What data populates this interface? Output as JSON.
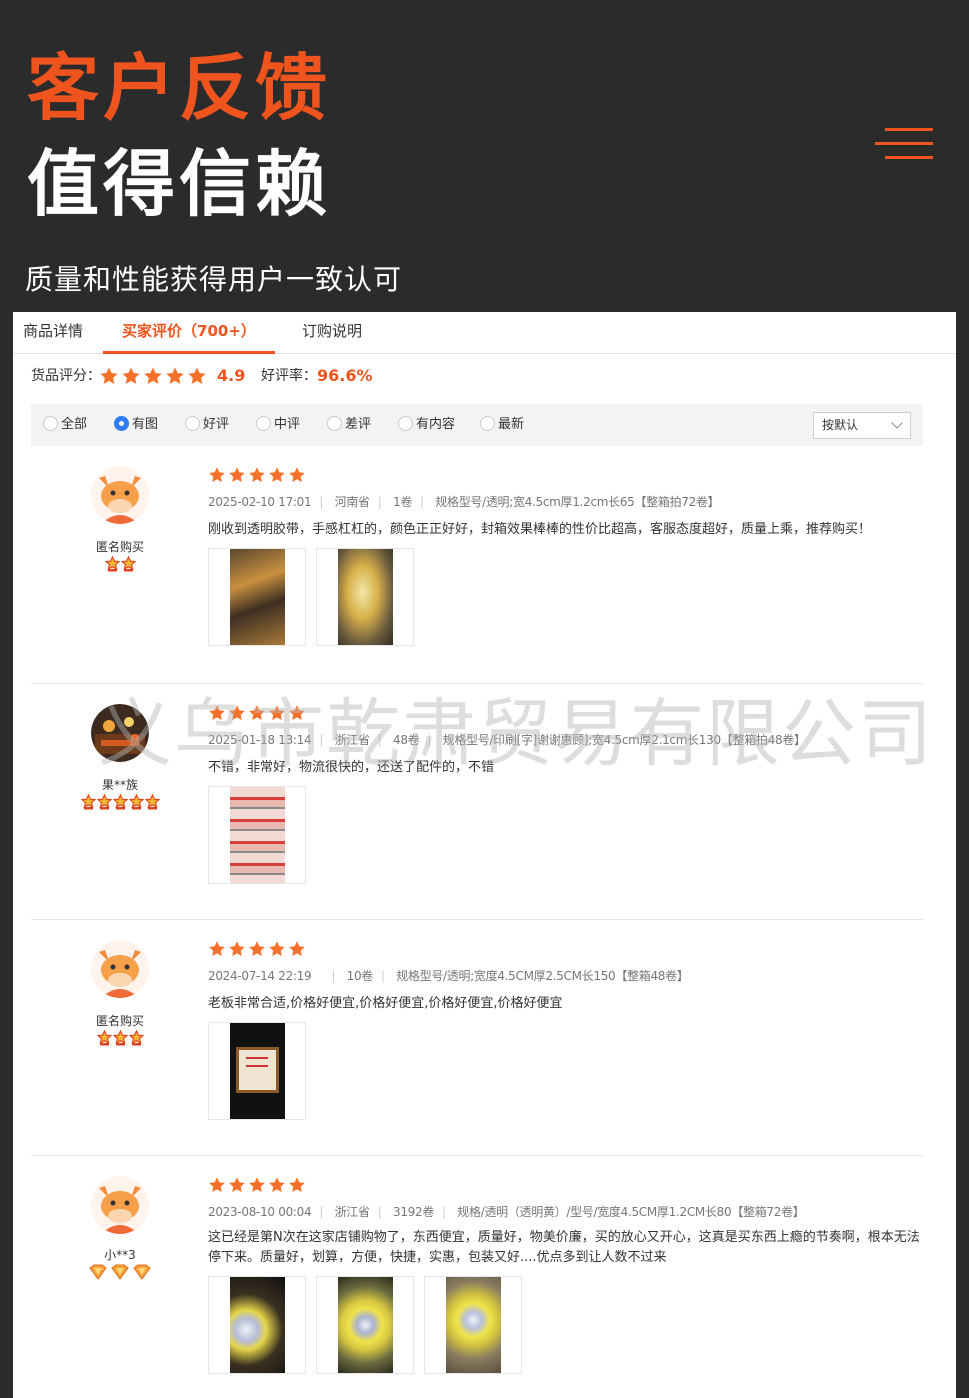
{
  "header": {
    "title_line1": "客户反馈",
    "title_line2": "值得信赖",
    "subtitle": "质量和性能获得用户一致认可"
  },
  "tabs": [
    {
      "label": "商品详情"
    },
    {
      "label": "买家评价（700+）",
      "active": true
    },
    {
      "label": "订购说明"
    }
  ],
  "score": {
    "label": "货品评分：",
    "stars": 5,
    "value": "4.9",
    "rate_label": "好评率：",
    "rate_value": "96.6%"
  },
  "filters": {
    "options": [
      "全部",
      "有图",
      "好评",
      "中评",
      "差评",
      "有内容",
      "最新"
    ],
    "selected": "有图",
    "sort_label": "按默认"
  },
  "watermark": "义乌市乾肃贸易有限公司",
  "reviews": [
    {
      "username": "匿名购买",
      "badge_type": "crown",
      "badge_count": 2,
      "stars": 5,
      "date": "2025-02-10 17:01",
      "province": "河南省",
      "qty": "1卷",
      "spec": "规格型号/透明;宽4.5cm厚1.2cm长65【整箱拍72卷】",
      "comment": "刚收到透明胶带，手感杠杠的，颜色正正好好，封箱效果棒棒的性价比超高，客服态度超好，质量上乘，推荐购买！",
      "photos": [
        "photo-tape-box",
        "photo-tape-roll"
      ]
    },
    {
      "username": "果**族",
      "badge_type": "crown",
      "badge_count": 5,
      "stars": 5,
      "date": "2025-01-18 13:14",
      "province": "浙江省",
      "qty": "48卷",
      "spec": "规格型号/印刷[字]谢谢惠顾];宽4.5cm厚2.1cm长130【整箱拍48卷】",
      "comment": "不错，非常好，物流很快的，还送了配件的，不错",
      "photos": [
        "photo-printed-tape"
      ]
    },
    {
      "username": "匿名购买",
      "badge_type": "crown",
      "badge_count": 3,
      "stars": 5,
      "date": "2024-07-14 22:19",
      "province": "",
      "qty": "10卷",
      "spec": "规格型号/透明;宽度4.5CM厚2.5CM长150【整箱48卷】",
      "comment": "老板非常合适,价格好便宜,价格好便宜,价格好便宜,价格好便宜",
      "photos": [
        "photo-phone-screen"
      ]
    },
    {
      "username": "小**3",
      "badge_type": "heart",
      "badge_count": 3,
      "stars": 5,
      "date": "2023-08-10 00:04",
      "province": "浙江省",
      "qty": "3192卷",
      "spec": "规格/透明（透明黄）/型号/宽度4.5CM厚1.2CM长80【整箱72卷】",
      "comment": "这已经是第N次在这家店铺购物了，东西便宜，质量好，物美价廉，买的放心又开心，这真是买东西上瘾的节奏啊，根本无法停下来。质量好，划算，方便，快捷，实惠，包装又好....优点多到让人数不过来",
      "photos": [
        "photo-tape-stack",
        "photo-yellow-roll",
        "photo-tape-hand"
      ]
    }
  ],
  "colors": {
    "accent": "#f0541e",
    "header_bg": "#2b2b2b",
    "star": "#f7712b",
    "radio_checked": "#2e7cf6"
  }
}
